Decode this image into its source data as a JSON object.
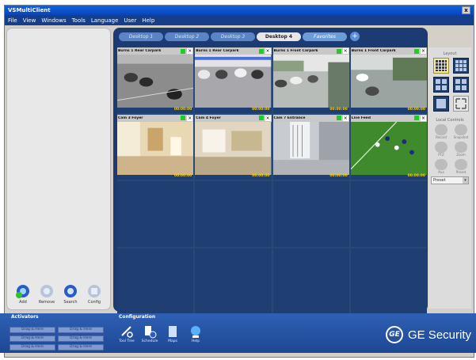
{
  "window": {
    "title": "VSMultiClient",
    "close": "x"
  },
  "menu": [
    "File",
    "View",
    "Windows",
    "Tools",
    "Language",
    "User",
    "Help"
  ],
  "left_panel": {
    "buttons": [
      {
        "label": "Add",
        "icon": "camera-add-icon"
      },
      {
        "label": "Remove",
        "icon": "camera-remove-icon"
      },
      {
        "label": "Search",
        "icon": "camera-search-icon"
      },
      {
        "label": "Config",
        "icon": "camera-config-icon"
      }
    ]
  },
  "tabs": [
    {
      "label": "Desktop 1",
      "active": false
    },
    {
      "label": "Desktop 2",
      "active": false
    },
    {
      "label": "Desktop 3",
      "active": false
    },
    {
      "label": "Desktop 4",
      "active": true
    },
    {
      "label": "Favorites",
      "active": false
    }
  ],
  "tab_add": "+",
  "cameras": [
    {
      "name": "Burns 1 Rear Carpark",
      "ts": "00:00:00"
    },
    {
      "name": "Burns 1 Rear Carpark",
      "ts": "00:00:00"
    },
    {
      "name": "Burns 1 Front Carpark",
      "ts": "00:00:00"
    },
    {
      "name": "Burns 1 Front Carpark",
      "ts": "00:00:00"
    },
    {
      "name": "Cam 3 Foyer",
      "ts": "00:00:00"
    },
    {
      "name": "Cam 4 Foyer",
      "ts": "00:00:00"
    },
    {
      "name": "Cam 7 Entrance",
      "ts": "00:00:00"
    },
    {
      "name": "Live Feed",
      "ts": "00:00:00"
    }
  ],
  "right_panel": {
    "layout_label": "Layout",
    "control_label": "Local Controls",
    "controls": [
      "Record",
      "Snapshot",
      "PTZ",
      "Zoom",
      "Aux",
      "Preset"
    ],
    "select": "Preset"
  },
  "bottom": {
    "activators_label": "Activators",
    "configuration_label": "Configuration",
    "activators": [
      "Drag & Here",
      "Drag & Here",
      "Drag & Here",
      "Drag & Here",
      "Drag & Here",
      "Drag & Here"
    ],
    "tools": [
      {
        "label": "Tool Tree",
        "icon": "tools-icon"
      },
      {
        "label": "Schedule",
        "icon": "schedule-icon"
      },
      {
        "label": "Maps",
        "icon": "map-icon"
      },
      {
        "label": "Help",
        "icon": "help-icon"
      }
    ],
    "brand": "GE Security",
    "brand_logo": "GE"
  },
  "colors": {
    "accent": "#1d4793",
    "video_bg": "#1f3f72",
    "rec": "#22cc22",
    "timestamp": "#ffd400"
  }
}
